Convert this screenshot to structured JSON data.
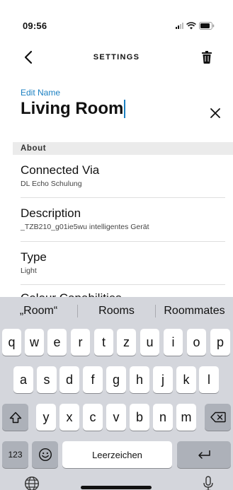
{
  "status_bar": {
    "time": "09:56"
  },
  "header": {
    "title": "SETTINGS"
  },
  "name_edit": {
    "label": "Edit Name",
    "value": "Living Room"
  },
  "section": {
    "title": "About"
  },
  "rows": [
    {
      "title": "Connected Via",
      "subtitle": "DL Echo Schulung"
    },
    {
      "title": "Description",
      "subtitle": "_TZB210_g01ie5wu intelligentes Gerät"
    },
    {
      "title": "Type",
      "subtitle": "Light"
    }
  ],
  "partial_row_title": "Colour Capabilities",
  "keyboard": {
    "suggestions": [
      "„Room“",
      "Rooms",
      "Roommates"
    ],
    "row1": [
      "q",
      "w",
      "e",
      "r",
      "t",
      "z",
      "u",
      "i",
      "o",
      "p"
    ],
    "row2": [
      "a",
      "s",
      "d",
      "f",
      "g",
      "h",
      "j",
      "k",
      "l"
    ],
    "row3": [
      "y",
      "x",
      "c",
      "v",
      "b",
      "n",
      "m"
    ],
    "numbers_label": "123",
    "space_label": "Leerzeichen"
  },
  "icons": {
    "back": "chevron-left-icon",
    "trash": "trash-icon",
    "clear": "close-icon",
    "shift": "shift-icon",
    "delete": "backspace-icon",
    "emoji": "emoji-icon",
    "return": "return-icon",
    "globe": "globe-icon",
    "mic": "microphone-icon"
  },
  "colors": {
    "accent": "#1a7fc1",
    "section_bg": "#ebebeb",
    "keyboard_bg": "#d4d6dc",
    "fn_key_bg": "#adb1b9"
  }
}
